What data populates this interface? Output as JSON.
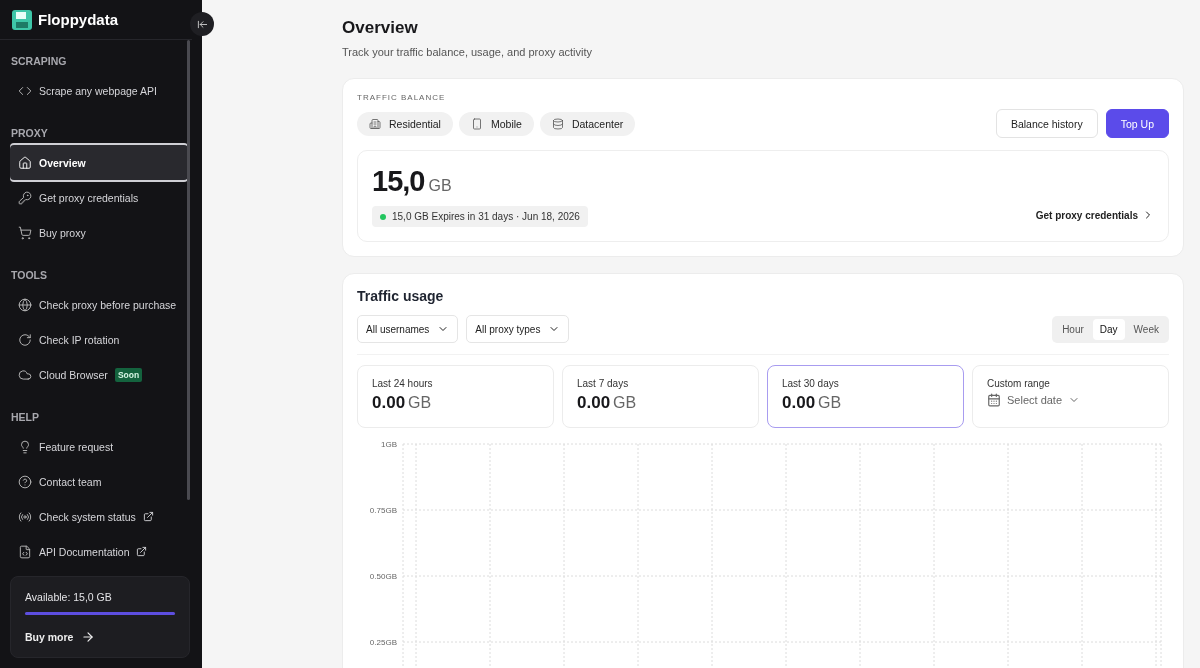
{
  "brand": {
    "name": "Floppydata"
  },
  "sidebar": {
    "sections": [
      {
        "title": "SCRAPING",
        "items": [
          {
            "label": "Scrape any webpage API",
            "selected": false
          }
        ]
      },
      {
        "title": "PROXY",
        "items": [
          {
            "label": "Overview",
            "selected": true
          },
          {
            "label": "Get proxy credentials",
            "selected": false
          },
          {
            "label": "Buy proxy",
            "selected": false
          }
        ]
      },
      {
        "title": "TOOLS",
        "items": [
          {
            "label": "Check proxy before purchase",
            "selected": false
          },
          {
            "label": "Check IP rotation",
            "selected": false
          },
          {
            "label": "Cloud Browser",
            "selected": false,
            "badge": "Soon"
          }
        ]
      },
      {
        "title": "HELP",
        "items": [
          {
            "label": "Feature request",
            "selected": false
          },
          {
            "label": "Contact team",
            "selected": false
          },
          {
            "label": "Check system status",
            "selected": false,
            "external": true
          },
          {
            "label": "API Documentation",
            "selected": false,
            "external": true
          }
        ]
      }
    ],
    "balance_card": {
      "label": "Available: 15,0 GB",
      "level": 1,
      "link": "Buy more"
    }
  },
  "page": {
    "title": "Overview",
    "subtitle": "Track your traffic balance, usage, and proxy activity"
  },
  "traffic_balance": {
    "heading": "TRAFFIC BALANCE",
    "types": [
      "Residential",
      "Mobile",
      "Datacenter"
    ],
    "buttons": [
      {
        "label": "Balance history",
        "kind": "secondary"
      },
      {
        "label": "Top Up",
        "kind": "primary"
      }
    ],
    "amount": "15,0",
    "unit": "GB",
    "status": {
      "text": "15,0 GB Expires in 31 days · Jun 18, 2026",
      "color": "#22c55e"
    },
    "link": "Get proxy credentials"
  },
  "traffic_usage": {
    "title": "Traffic usage",
    "filters": [
      "All usernames",
      "All proxy types"
    ],
    "intervals": [
      {
        "label": "Hour",
        "selected": false
      },
      {
        "label": "Day",
        "selected": true
      },
      {
        "label": "Week",
        "selected": false
      }
    ],
    "stats": [
      {
        "label": "Last 24 hours",
        "value": "0.00",
        "unit": "GB",
        "selected": false,
        "kind": "stat"
      },
      {
        "label": "Last 7 days",
        "value": "0.00",
        "unit": "GB",
        "selected": false,
        "kind": "stat"
      },
      {
        "label": "Last 30 days",
        "value": "0.00",
        "unit": "GB",
        "selected": true,
        "kind": "stat"
      },
      {
        "label": "Custom range",
        "placeholder": "Select date",
        "selected": false,
        "kind": "range"
      }
    ],
    "chart": {
      "y_axis_labels": [
        "1GB",
        "0.75GB",
        "0.50GB",
        "0.25GB"
      ]
    }
  }
}
